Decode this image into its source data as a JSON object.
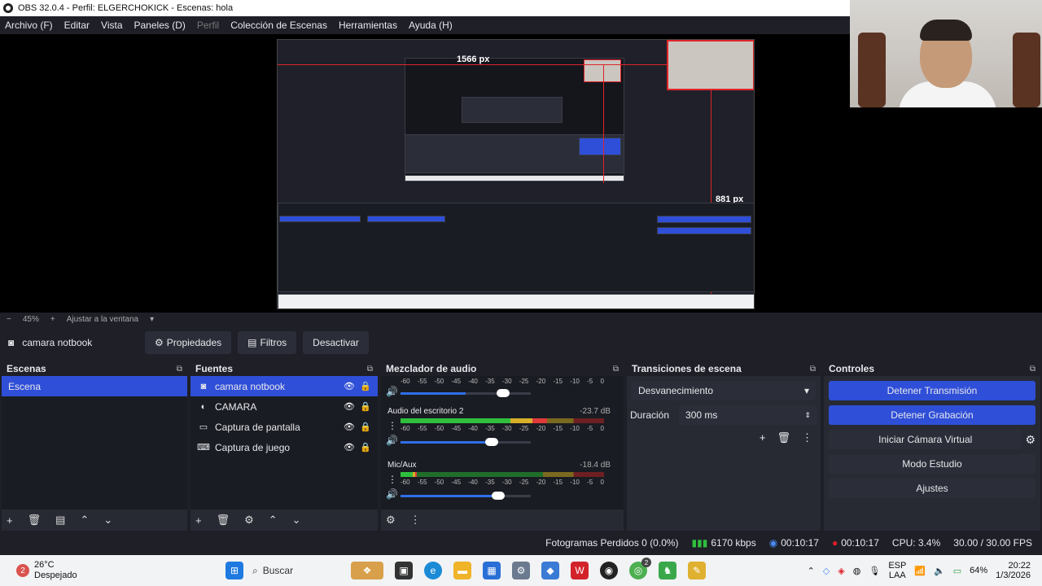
{
  "window": {
    "title": "OBS 32.0.4 - Perfil: ELGERCHOKICK - Escenas: hola"
  },
  "menu": [
    "Archivo (F)",
    "Editar",
    "Vista",
    "Paneles (D)",
    "Perfil",
    "Colección de Escenas",
    "Herramientas",
    "Ayuda (H)"
  ],
  "preview": {
    "width_label": "1566 px",
    "height_label": "881 px"
  },
  "zoom": {
    "minus": "−",
    "value": "45%",
    "plus": "+",
    "fit": "Ajustar a la ventana"
  },
  "source_bar": {
    "source": "camara notbook",
    "properties": "Propiedades",
    "filters": "Filtros",
    "deactivate": "Desactivar"
  },
  "scenes": {
    "title": "Escenas",
    "items": [
      "Escena"
    ]
  },
  "sources": {
    "title": "Fuentes",
    "items": [
      "camara notbook",
      "CAMARA",
      "Captura de pantalla",
      "Captura de juego"
    ]
  },
  "mixer": {
    "title": "Mezclador de audio",
    "scale": [
      "-60",
      "-55",
      "-50",
      "-45",
      "-40",
      "-35",
      "-30",
      "-25",
      "-20",
      "-15",
      "-10",
      "-5",
      "0"
    ],
    "channels": [
      {
        "name": "Audio del escritorio 2",
        "db": "-23.7 dB",
        "level": 0.72,
        "volume": 0.7
      },
      {
        "name": "Mic/Aux",
        "db": "-18.4 dB",
        "level": 0.08,
        "volume": 0.75
      }
    ]
  },
  "transitions": {
    "title": "Transiciones de escena",
    "selected": "Desvanecimiento",
    "duration_label": "Duración",
    "duration_value": "300 ms"
  },
  "controls": {
    "title": "Controles",
    "stop_stream": "Detener Transmisión",
    "stop_record": "Detener Grabación",
    "virtual_cam": "Iniciar Cámara Virtual",
    "studio_mode": "Modo Estudio",
    "settings": "Ajustes"
  },
  "status": {
    "dropped": "Fotogramas Perdidos 0 (0.0%)",
    "kbps": "6170 kbps",
    "stream_time": "00:10:17",
    "rec_time": "00:10:17",
    "cpu": "CPU: 3.4%",
    "fps": "30.00 / 30.00 FPS"
  },
  "taskbar": {
    "temp": "26°C",
    "weather": "Despejado",
    "weather_badge": "2",
    "search": "Buscar",
    "lang": "ESP",
    "layout": "LAA",
    "battery": "64%",
    "time": "20:22",
    "date": "1/3/2026",
    "chrome_badge": "2"
  },
  "colors": {
    "accent": "#2f4fd8",
    "background": "#1e1f27",
    "panel": "#272a33",
    "record": "#e01e2a"
  }
}
